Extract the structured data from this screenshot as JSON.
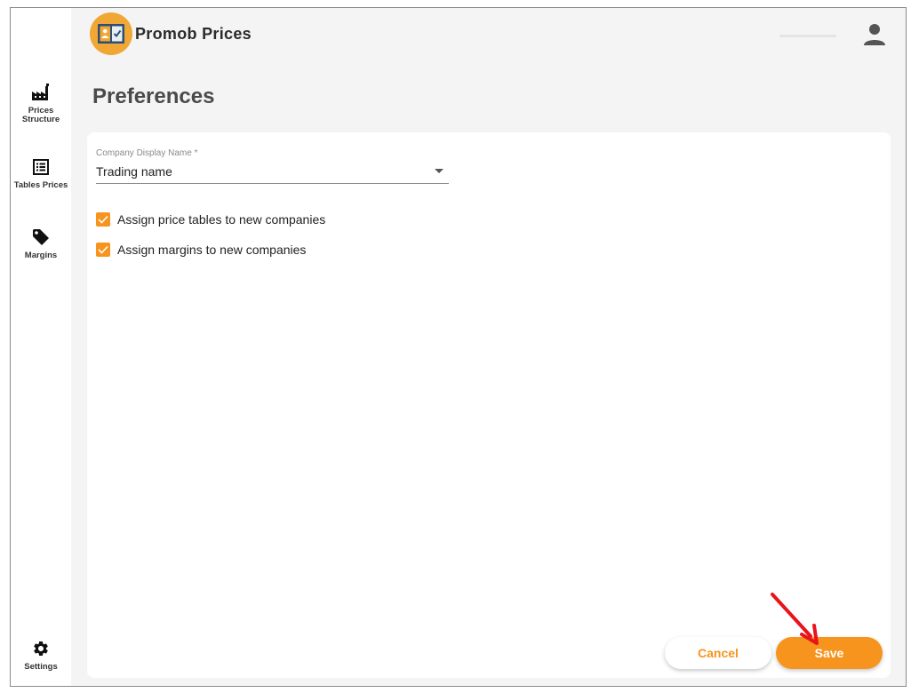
{
  "app": {
    "title": "Promob Prices"
  },
  "sidebar": {
    "items": [
      {
        "label": "Prices Structure",
        "icon": "factory-icon"
      },
      {
        "label": "Tables Prices",
        "icon": "list-icon"
      },
      {
        "label": "Margins",
        "icon": "tag-icon"
      }
    ],
    "settings": {
      "label": "Settings",
      "icon": "gear-icon"
    }
  },
  "page": {
    "title": "Preferences"
  },
  "form": {
    "display_name": {
      "label": "Company Display Name *",
      "value": "Trading name"
    },
    "checkboxes": [
      {
        "label": "Assign price tables to new companies",
        "checked": true
      },
      {
        "label": "Assign margins to new companies",
        "checked": true
      }
    ]
  },
  "actions": {
    "cancel_label": "Cancel",
    "save_label": "Save"
  },
  "colors": {
    "accent": "#f7941d",
    "logo_bg": "#f0a736",
    "annotation_arrow": "#e8141b"
  }
}
